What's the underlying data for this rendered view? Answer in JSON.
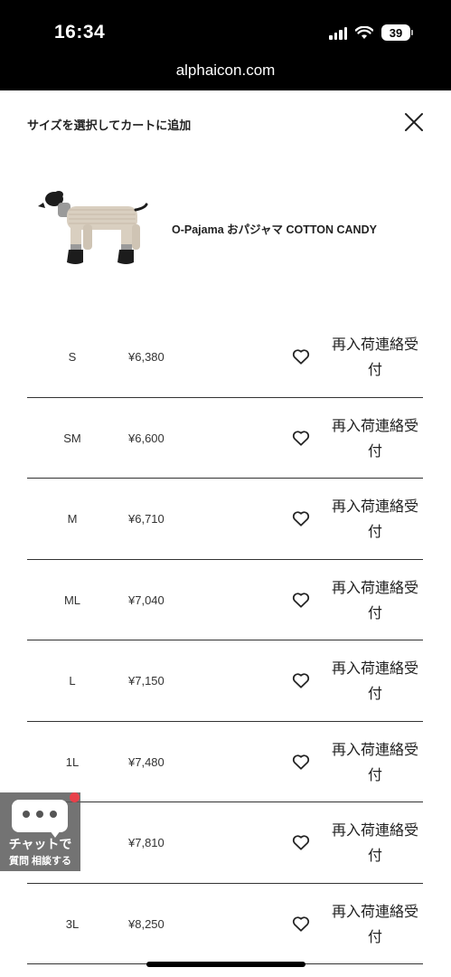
{
  "status_bar": {
    "time": "16:34",
    "battery": "39",
    "url": "alphaicon.com"
  },
  "sheet": {
    "title": "サイズを選択してカートに追加",
    "close_icon": "close-icon"
  },
  "product": {
    "name": "O-Pajama おパジャマ COTTON CANDY",
    "image_icon": "dog-pajama-image"
  },
  "sizes": [
    {
      "size": "S",
      "price": "¥6,380",
      "restock": "再入荷連絡受付"
    },
    {
      "size": "SM",
      "price": "¥6,600",
      "restock": "再入荷連絡受付"
    },
    {
      "size": "M",
      "price": "¥6,710",
      "restock": "再入荷連絡受付"
    },
    {
      "size": "ML",
      "price": "¥7,040",
      "restock": "再入荷連絡受付"
    },
    {
      "size": "L",
      "price": "¥7,150",
      "restock": "再入荷連絡受付"
    },
    {
      "size": "1L",
      "price": "¥7,480",
      "restock": "再入荷連絡受付"
    },
    {
      "size": "",
      "price": "¥7,810",
      "restock": "再入荷連絡受付"
    },
    {
      "size": "3L",
      "price": "¥8,250",
      "restock": "再入荷連絡受付"
    }
  ],
  "chat": {
    "line1": "チャットで",
    "line2": "質問 相談する",
    "badge_color": "#e8404a"
  }
}
